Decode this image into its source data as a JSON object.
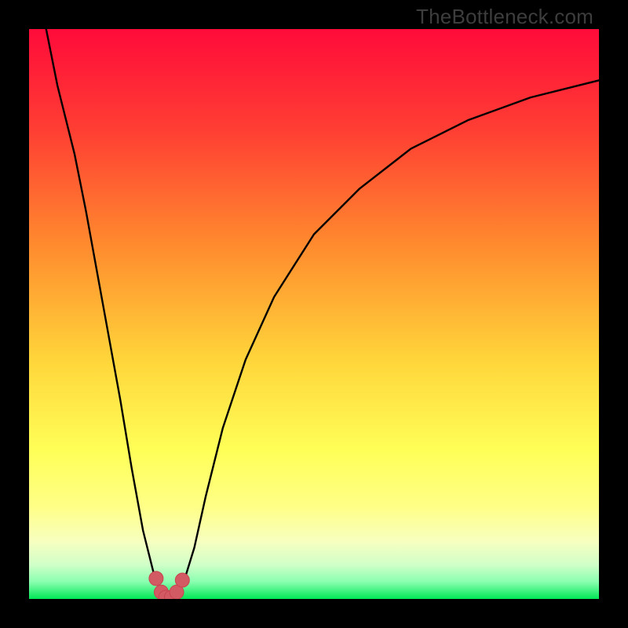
{
  "watermark": "TheBottleneck.com",
  "colors": {
    "frame": "#000000",
    "grad_top": "#ff0b3a",
    "grad_mid1": "#ff6a2a",
    "grad_mid2": "#ffd53a",
    "grad_mid3": "#ffff66",
    "grad_mid4": "#f3ffb0",
    "grad_bot": "#00e756",
    "curve": "#000000",
    "marker_fill": "#d25a63",
    "marker_stroke": "#c9444f"
  },
  "chart_data": {
    "type": "line",
    "title": "",
    "xlabel": "",
    "ylabel": "",
    "xlim": [
      0,
      100
    ],
    "ylim": [
      0,
      100
    ],
    "annotations": [
      "TheBottleneck.com"
    ],
    "series": [
      {
        "name": "bottleneck-curve",
        "x": [
          3,
          5,
          8,
          10,
          12,
          14,
          16,
          18,
          20,
          22,
          23,
          24,
          25,
          26,
          27,
          29,
          31,
          34,
          38,
          43,
          50,
          58,
          67,
          77,
          88,
          100
        ],
        "y": [
          100,
          90,
          78,
          68,
          57,
          46,
          35,
          23,
          12,
          4,
          1.5,
          0.4,
          0.3,
          0.8,
          2.5,
          9,
          18,
          30,
          42,
          53,
          64,
          72,
          79,
          84,
          88,
          91
        ]
      }
    ],
    "markers": {
      "name": "trough-markers",
      "x": [
        22.3,
        23.2,
        24.0,
        25.0,
        25.9,
        26.9
      ],
      "y": [
        3.6,
        1.2,
        0.3,
        0.3,
        1.2,
        3.3
      ]
    }
  }
}
